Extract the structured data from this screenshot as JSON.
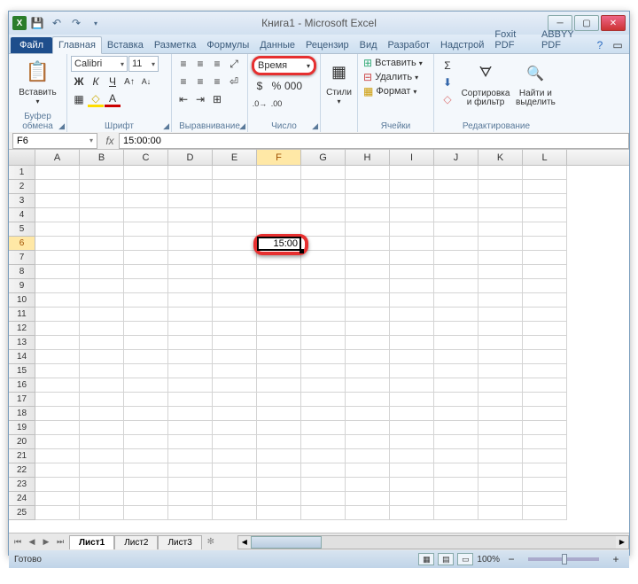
{
  "title": "Книга1 - Microsoft Excel",
  "tabs": {
    "file": "Файл",
    "home": "Главная",
    "insert": "Вставка",
    "layout": "Разметка",
    "formulas": "Формулы",
    "data": "Данные",
    "review": "Рецензир",
    "view": "Вид",
    "dev": "Разработ",
    "addins": "Надстрой",
    "foxit": "Foxit PDF",
    "abbyy": "ABBYY PDF"
  },
  "ribbon": {
    "clipboard": {
      "paste": "Вставить",
      "label": "Буфер обмена"
    },
    "font": {
      "name": "Calibri",
      "size": "11",
      "label": "Шрифт"
    },
    "align": {
      "label": "Выравнивание"
    },
    "number": {
      "format": "Время",
      "label": "Число"
    },
    "styles": {
      "btn": "Стили"
    },
    "cells": {
      "insert": "Вставить",
      "delete": "Удалить",
      "format": "Формат",
      "label": "Ячейки"
    },
    "editing": {
      "sort": "Сортировка и фильтр",
      "find": "Найти и выделить",
      "label": "Редактирование"
    }
  },
  "name_box": "F6",
  "formula": "15:00:00",
  "columns": [
    "A",
    "B",
    "C",
    "D",
    "E",
    "F",
    "G",
    "H",
    "I",
    "J",
    "K",
    "L"
  ],
  "active_col": "F",
  "row_count": 25,
  "active_row": 6,
  "cell_value": "15:00",
  "sheets": {
    "s1": "Лист1",
    "s2": "Лист2",
    "s3": "Лист3"
  },
  "status": {
    "ready": "Готово",
    "zoom": "100%"
  }
}
